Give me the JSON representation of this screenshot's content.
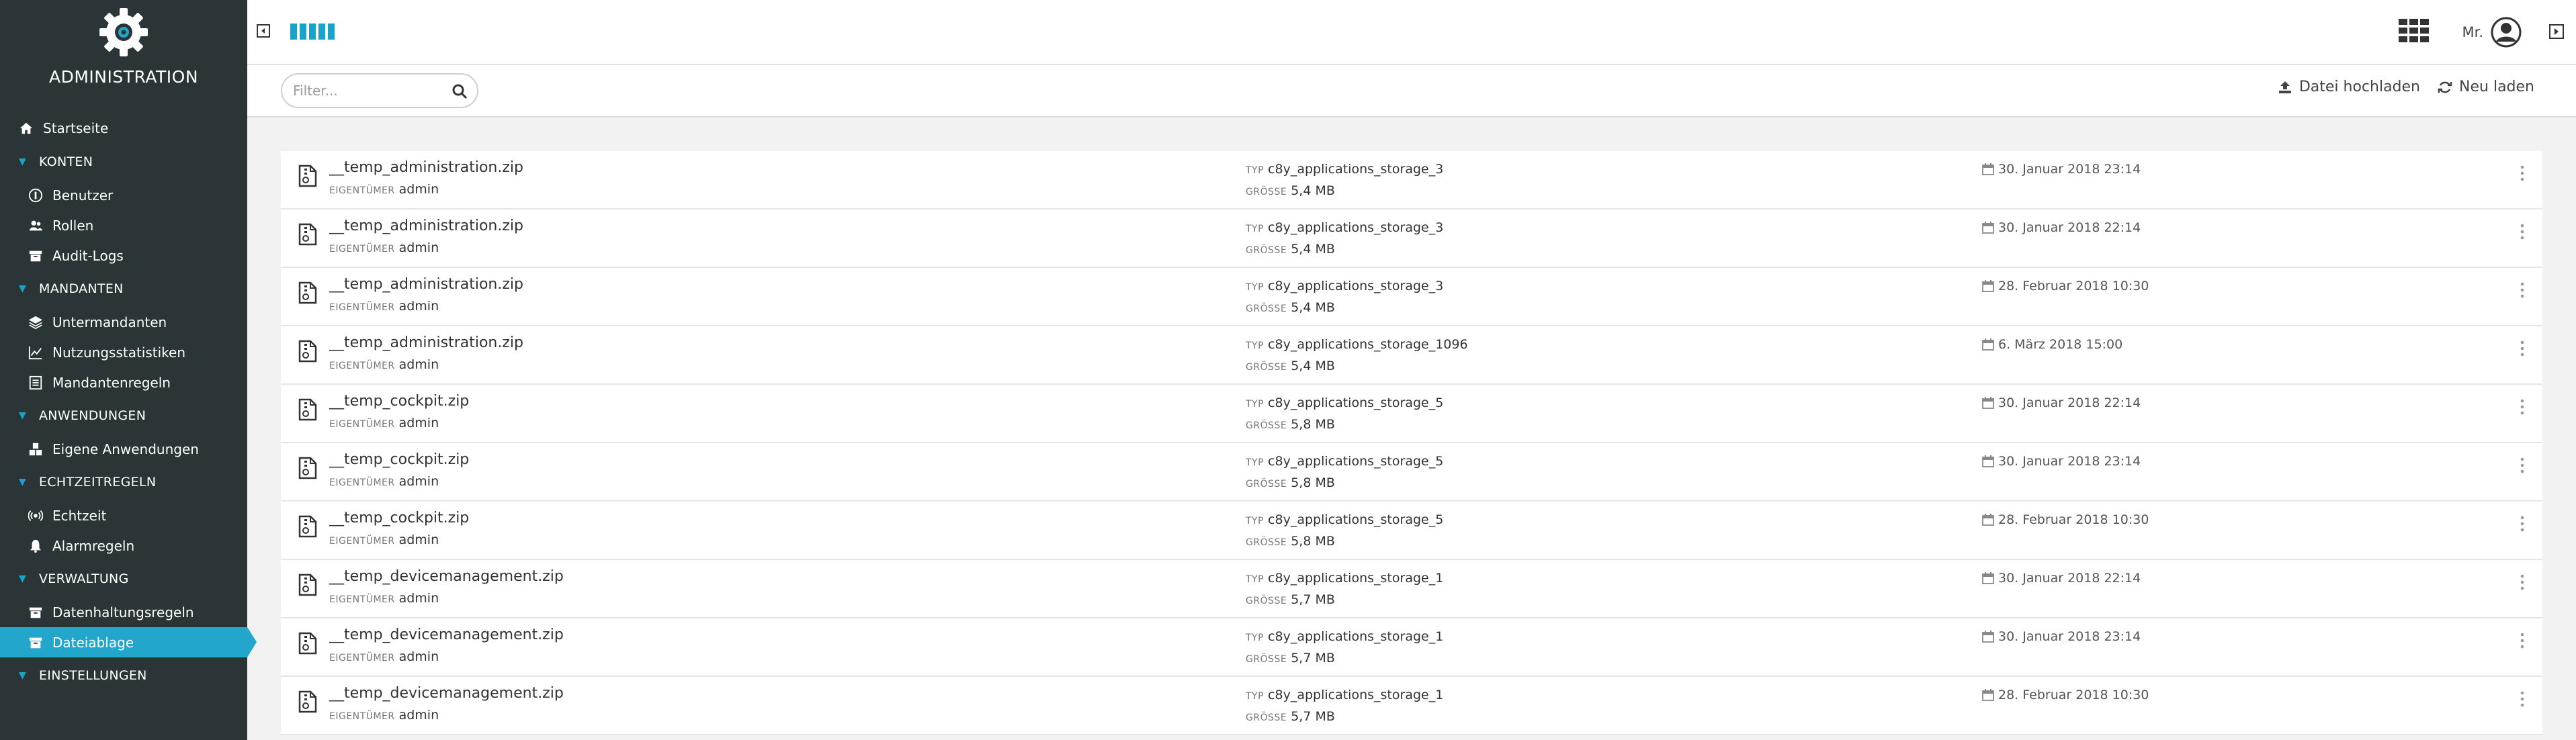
{
  "brand": {
    "title": "ADMINISTRATION"
  },
  "sidebar": {
    "home": {
      "label": "Startseite",
      "icon": "home-icon"
    },
    "sections": [
      {
        "title": "KONTEN",
        "items": [
          {
            "label": "Benutzer",
            "icon": "user-icon"
          },
          {
            "label": "Rollen",
            "icon": "roles-icon"
          },
          {
            "label": "Audit-Logs",
            "icon": "archive-icon"
          }
        ]
      },
      {
        "title": "MANDANTEN",
        "items": [
          {
            "label": "Untermandanten",
            "icon": "layers-icon"
          },
          {
            "label": "Nutzungsstatistiken",
            "icon": "chart-icon"
          },
          {
            "label": "Mandantenregeln",
            "icon": "list-icon"
          }
        ]
      },
      {
        "title": "ANWENDUNGEN",
        "items": [
          {
            "label": "Eigene Anwendungen",
            "icon": "cubes-icon"
          }
        ]
      },
      {
        "title": "ECHTZEITREGELN",
        "items": [
          {
            "label": "Echtzeit",
            "icon": "broadcast-icon"
          },
          {
            "label": "Alarmregeln",
            "icon": "bell-icon"
          }
        ]
      },
      {
        "title": "VERWALTUNG",
        "items": [
          {
            "label": "Datenhaltungsregeln",
            "icon": "archive-icon"
          },
          {
            "label": "Dateiablage",
            "icon": "archive-icon",
            "active": true
          }
        ]
      },
      {
        "title": "EINSTELLUNGEN",
        "items": []
      }
    ]
  },
  "topbar": {
    "user_label": "Mr."
  },
  "actionbar": {
    "filter_placeholder": "Filter...",
    "upload_label": "Datei hochladen",
    "reload_label": "Neu laden"
  },
  "labels": {
    "owner": "EIGENTÜMER",
    "type": "TYP",
    "size": "GRÖSSE"
  },
  "files": [
    {
      "name": "__temp_administration.zip",
      "owner": "admin",
      "type": "c8y_applications_storage_3",
      "size": "5,4 MB",
      "date": "30. Januar 2018 23:14"
    },
    {
      "name": "__temp_administration.zip",
      "owner": "admin",
      "type": "c8y_applications_storage_3",
      "size": "5,4 MB",
      "date": "30. Januar 2018 22:14"
    },
    {
      "name": "__temp_administration.zip",
      "owner": "admin",
      "type": "c8y_applications_storage_3",
      "size": "5,4 MB",
      "date": "28. Februar 2018 10:30"
    },
    {
      "name": "__temp_administration.zip",
      "owner": "admin",
      "type": "c8y_applications_storage_1096",
      "size": "5,4 MB",
      "date": "6. März 2018 15:00"
    },
    {
      "name": "__temp_cockpit.zip",
      "owner": "admin",
      "type": "c8y_applications_storage_5",
      "size": "5,8 MB",
      "date": "30. Januar 2018 22:14"
    },
    {
      "name": "__temp_cockpit.zip",
      "owner": "admin",
      "type": "c8y_applications_storage_5",
      "size": "5,8 MB",
      "date": "30. Januar 2018 23:14"
    },
    {
      "name": "__temp_cockpit.zip",
      "owner": "admin",
      "type": "c8y_applications_storage_5",
      "size": "5,8 MB",
      "date": "28. Februar 2018 10:30"
    },
    {
      "name": "__temp_devicemanagement.zip",
      "owner": "admin",
      "type": "c8y_applications_storage_1",
      "size": "5,7 MB",
      "date": "30. Januar 2018 22:14"
    },
    {
      "name": "__temp_devicemanagement.zip",
      "owner": "admin",
      "type": "c8y_applications_storage_1",
      "size": "5,7 MB",
      "date": "30. Januar 2018 23:14"
    },
    {
      "name": "__temp_devicemanagement.zip",
      "owner": "admin",
      "type": "c8y_applications_storage_1",
      "size": "5,7 MB",
      "date": "28. Februar 2018 10:30"
    }
  ],
  "colors": {
    "sidebar_bg": "#2b3538",
    "accent": "#22a6cc",
    "page_bg": "#f2f2f2"
  }
}
